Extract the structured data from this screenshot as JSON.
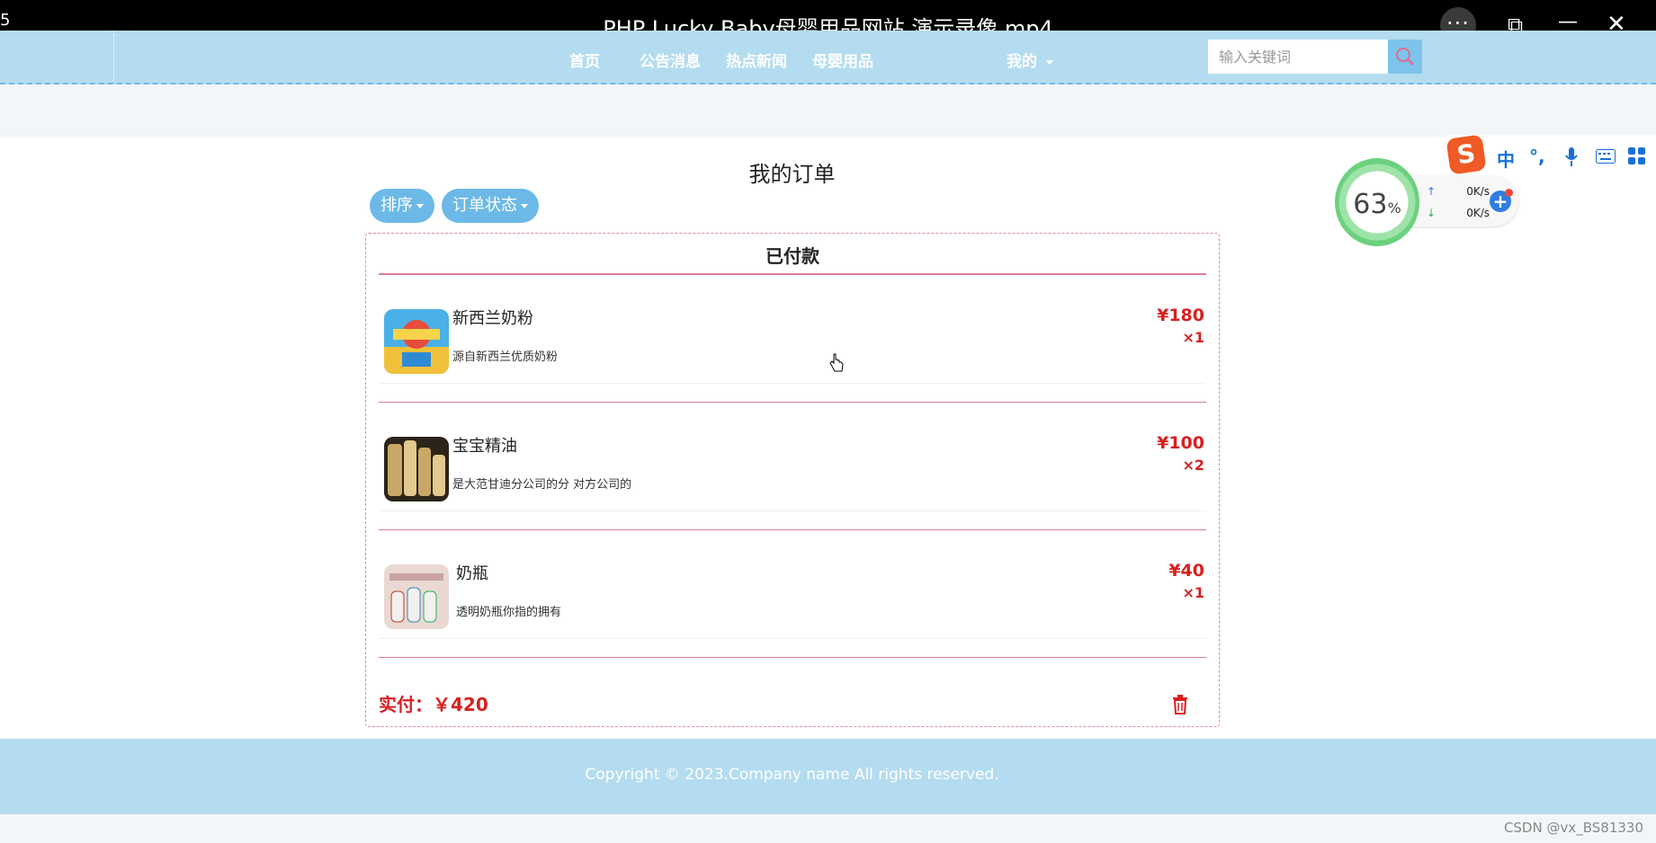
{
  "window": {
    "title": "PHP Lucky Baby母婴用品网站 演示录像.mp4",
    "edge_text": "5",
    "more_label": "···",
    "restore_label": "⧉",
    "minimize_label": "—",
    "close_label": "✕"
  },
  "nav": {
    "items": [
      "首页",
      "公告消息",
      "热点新闻",
      "母婴用品"
    ],
    "account_label": "我的",
    "search_placeholder": "输入关键词"
  },
  "page": {
    "title": "我的订单",
    "sort_label": "排序",
    "status_filter_label": "订单状态"
  },
  "order": {
    "status": "已付款",
    "items": [
      {
        "name": "新西兰奶粉",
        "desc": "源自新西兰优质奶粉",
        "price": "¥180",
        "qty": "×1"
      },
      {
        "name": "宝宝精油",
        "desc": "是大范甘迪分公司的分 对方公司的",
        "price": "¥100",
        "qty": "×2"
      },
      {
        "name": "奶瓶",
        "desc": "透明奶瓶你指的拥有",
        "price": "¥40",
        "qty": "×1"
      }
    ],
    "total": "实付：￥420"
  },
  "footer": {
    "copyright": "Copyright © 2023.Company name All rights reserved."
  },
  "widget": {
    "percent": "63",
    "percent_unit": "%",
    "upload": "0K/s",
    "download": "0K/s"
  },
  "ime": {
    "logo": "S",
    "lang": "中",
    "punct": "°,"
  },
  "watermark": "CSDN @vx_BS81330",
  "colors": {
    "nav_bg": "#b4dcf0",
    "accent": "#6cb9e8",
    "price": "#d91f1f",
    "divider": "#e07aa0"
  }
}
